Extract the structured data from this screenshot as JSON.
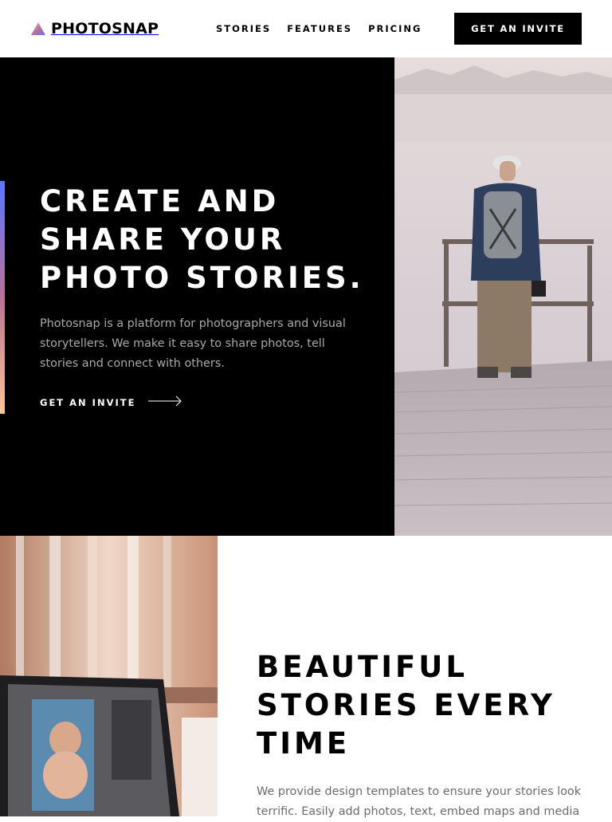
{
  "brand": {
    "name": "PHOTOSNAP",
    "logo_icon": "triangle-logo-icon",
    "gradient": [
      "#ffc593",
      "#bc7198",
      "#5a77ff"
    ]
  },
  "nav": {
    "items": [
      {
        "label": "STORIES"
      },
      {
        "label": "FEATURES"
      },
      {
        "label": "PRICING"
      }
    ]
  },
  "header": {
    "cta_label": "GET AN INVITE"
  },
  "hero": {
    "title": "CREATE AND SHARE YOUR PHOTO STORIES.",
    "text": "Photosnap is a platform for photographers and visual storytellers. We make it easy to share photos, tell stories and connect with others.",
    "link_label": "GET AN INVITE",
    "link_icon": "arrow-right-icon",
    "background": "#000000"
  },
  "feature": {
    "title": "BEAUTIFUL STORIES EVERY TIME",
    "text": "We provide design templates to ensure your stories look terrific. Easily add photos, text, embed maps and media"
  },
  "colors": {
    "text_dark": "#000000",
    "text_light": "#ffffff",
    "muted": "#a9a9a9",
    "body_grey": "#6b6b6b"
  }
}
